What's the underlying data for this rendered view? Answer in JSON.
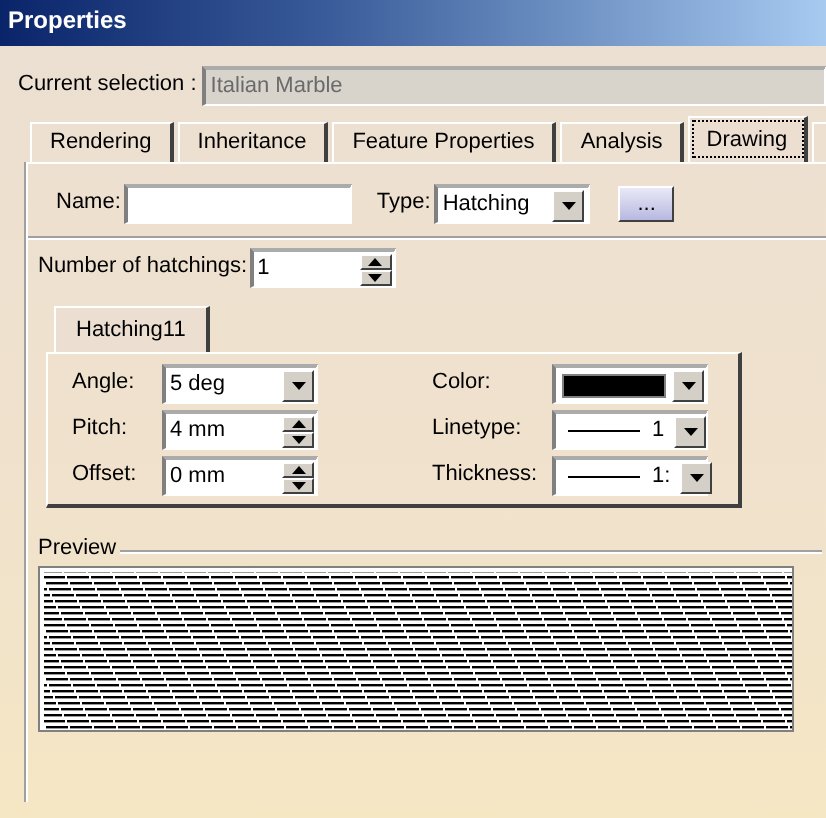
{
  "window": {
    "title": "Properties"
  },
  "current_selection": {
    "label": "Current selection :",
    "value": "Italian Marble"
  },
  "tabs": [
    {
      "label": "Rendering",
      "selected": false
    },
    {
      "label": "Inheritance",
      "selected": false
    },
    {
      "label": "Feature Properties",
      "selected": false
    },
    {
      "label": "Analysis",
      "selected": false
    },
    {
      "label": "Drawing",
      "selected": true
    }
  ],
  "name_field": {
    "label": "Name:"
  },
  "type_field": {
    "label": "Type:",
    "value": "Hatching"
  },
  "more_button": {
    "label": "..."
  },
  "number_of_hatchings": {
    "label": "Number of hatchings:",
    "value": "1"
  },
  "hatching_tabs": [
    {
      "label": "Hatching11",
      "selected": true
    }
  ],
  "left_params": [
    {
      "label": "Angle:",
      "value": "5 deg",
      "kind": "dropdown"
    },
    {
      "label": "Pitch:",
      "value": "4 mm",
      "kind": "spinner"
    },
    {
      "label": "Offset:",
      "value": "0 mm",
      "kind": "spinner"
    }
  ],
  "right_params": [
    {
      "label": "Color:",
      "kind": "swatch",
      "color": "#000000"
    },
    {
      "label": "Linetype:",
      "kind": "line",
      "value": "1"
    },
    {
      "label": "Thickness:",
      "kind": "line",
      "value": "1:"
    }
  ],
  "preview": {
    "label": "Preview"
  }
}
